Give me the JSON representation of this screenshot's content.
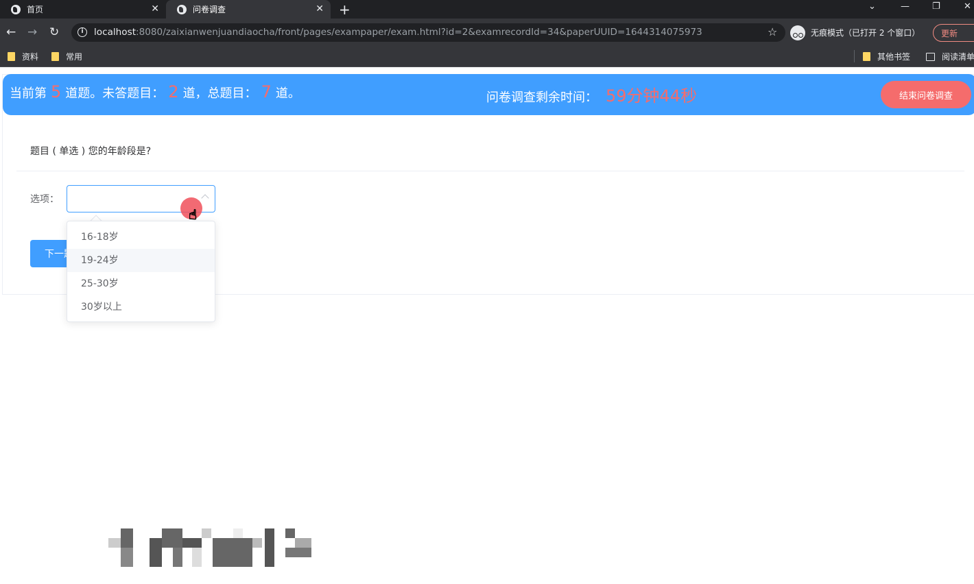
{
  "browser": {
    "tabs": [
      {
        "label": "首页",
        "active": false
      },
      {
        "label": "问卷调查",
        "active": true
      }
    ],
    "url_host": "localhost",
    "url_rest": ":8080/zaixianwenjuandiaocha/front/pages/exampaper/exam.html?id=2&examrecordId=34&paperUUID=1644314075973",
    "incognito_label": "无痕模式（已打开 2 个窗口）",
    "update_label": "更新",
    "bookmarks": [
      "资料",
      "常用",
      "其他书签",
      "阅读清单"
    ]
  },
  "banner": {
    "current_prefix": "当前第",
    "current_num": "5",
    "current_suffix": "道题。未答题目：",
    "unanswered_num": "2",
    "unanswered_suffix": "道，总题目：",
    "total_num": "7",
    "total_suffix": "道。",
    "timer_label": "问卷调查剩余时间：",
    "timer_value": "59分钟44秒",
    "end_button": "结束问卷调查",
    "accent": "#409eff",
    "highlight": "#f56c6c"
  },
  "question": {
    "text": "题目 ( 单选 ) 您的年龄段是?",
    "option_label": "选项：",
    "select_value": "",
    "options": [
      "16-18岁",
      "19-24岁",
      "25-30岁",
      "30岁以上"
    ],
    "hovered_option": "19-24岁",
    "next_button": "下一题"
  }
}
